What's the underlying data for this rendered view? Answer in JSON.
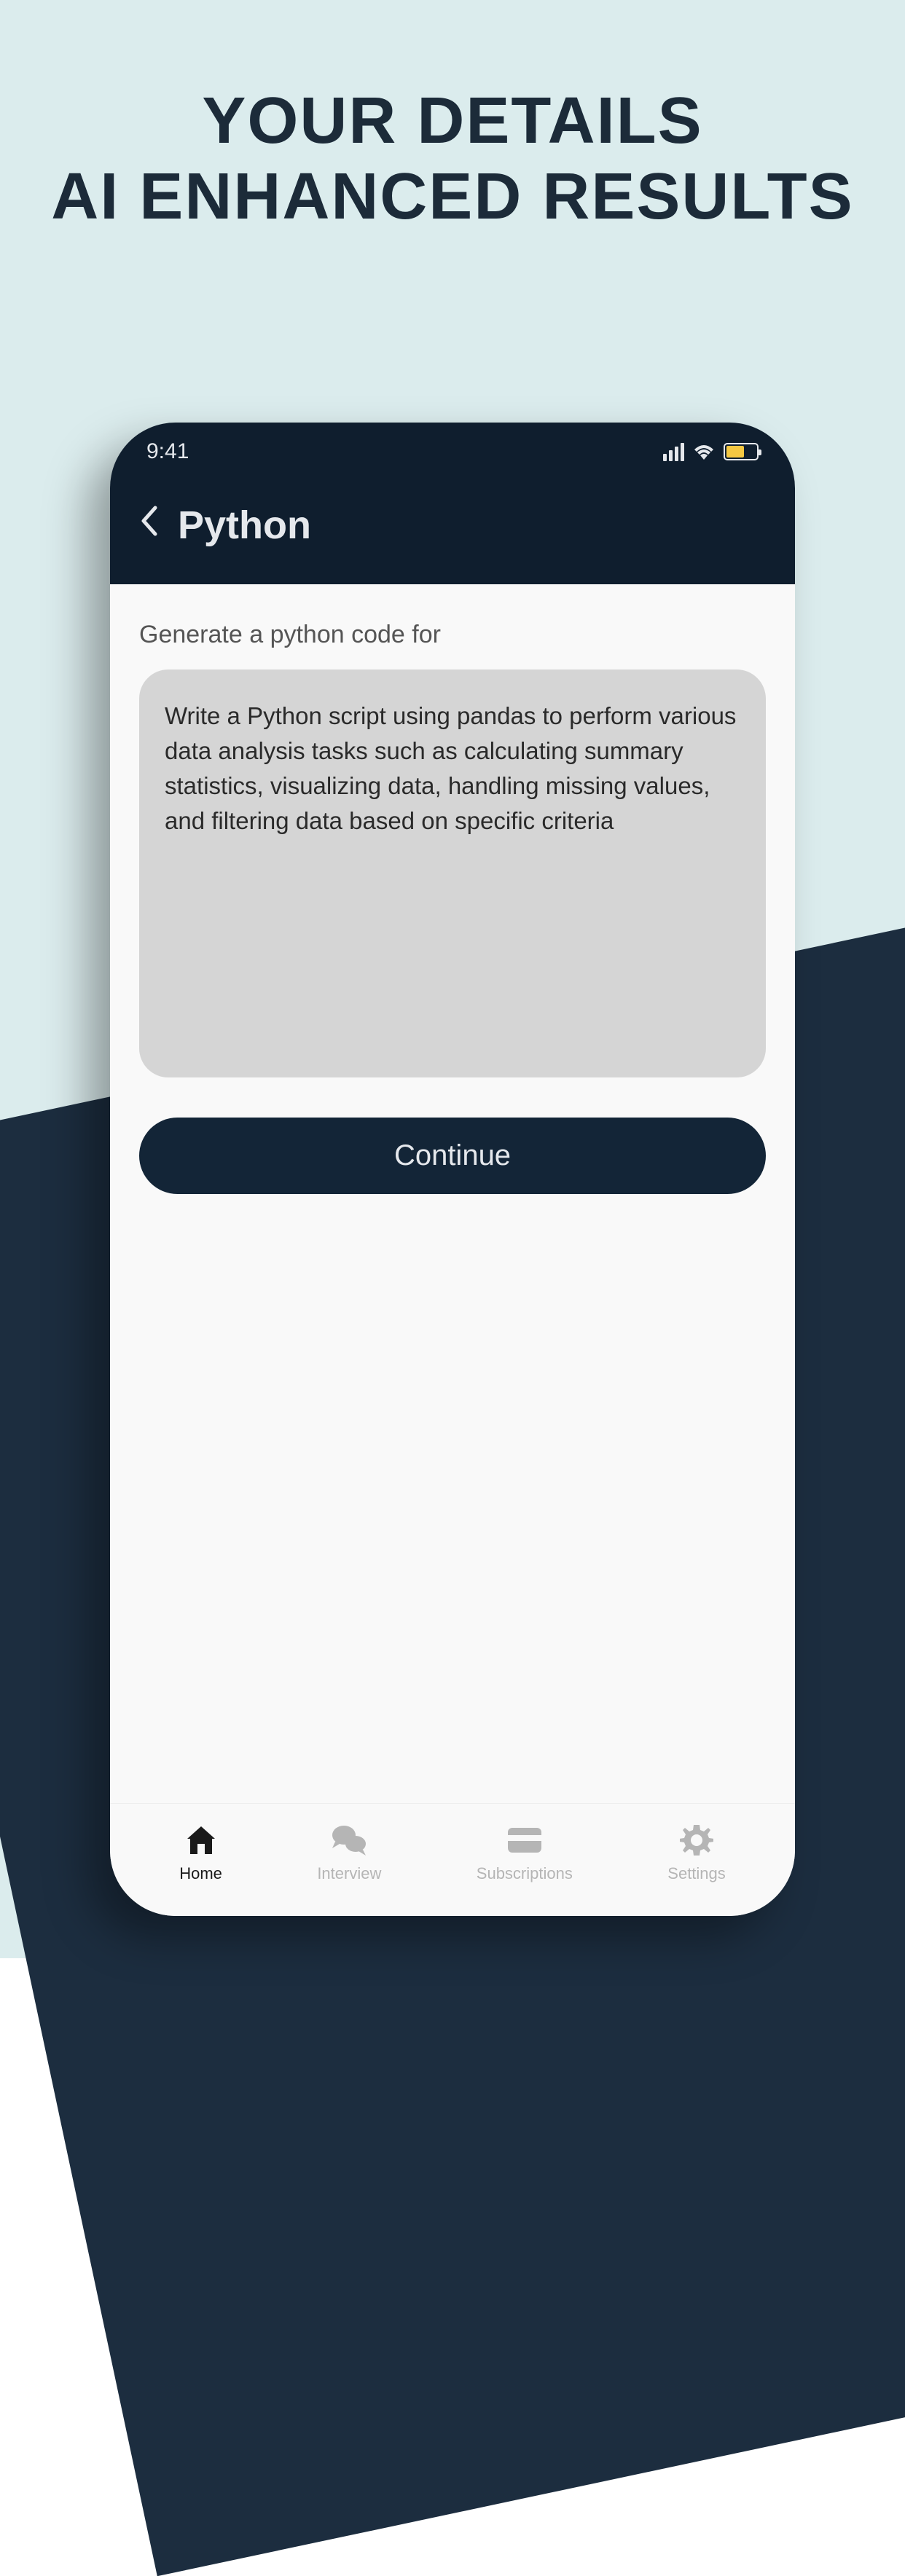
{
  "promo": {
    "line1": "YOUR DETAILS",
    "line2": "AI ENHANCED RESULTS"
  },
  "status_bar": {
    "time": "9:41"
  },
  "header": {
    "title": "Python"
  },
  "form": {
    "label": "Generate a python code for",
    "input_value": "Write a Python script using pandas to perform various data analysis tasks such as calculating summary statistics, visualizing data, handling missing values, and filtering data based on specific criteria",
    "submit_label": "Continue"
  },
  "bottom_nav": {
    "items": [
      {
        "label": "Home",
        "active": true
      },
      {
        "label": "Interview",
        "active": false
      },
      {
        "label": "Subscriptions",
        "active": false
      },
      {
        "label": "Settings",
        "active": false
      }
    ]
  }
}
